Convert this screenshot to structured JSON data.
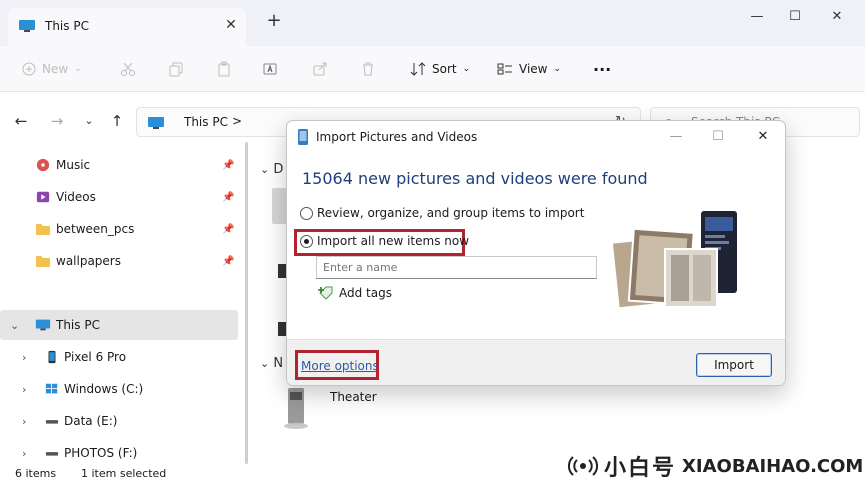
{
  "window": {
    "tab_title": "This PC",
    "tab_close": "✕",
    "new_tab": "+",
    "minimize": "—",
    "maximize": "☐",
    "close": "✕"
  },
  "toolbar": {
    "new_label": "New",
    "sort_label": "Sort",
    "view_label": "View",
    "more_label": "···"
  },
  "address": {
    "path": "This PC",
    "separator": ">",
    "search_placeholder": "Search This PC"
  },
  "sidebar": {
    "items": [
      {
        "label": "Music",
        "pinned": true
      },
      {
        "label": "Videos",
        "pinned": true
      },
      {
        "label": "between_pcs",
        "pinned": true
      },
      {
        "label": "wallpapers",
        "pinned": true
      },
      {
        "label": "This PC",
        "selected": true
      },
      {
        "label": "Pixel 6 Pro"
      },
      {
        "label": "Windows (C:)"
      },
      {
        "label": "Data (E:)"
      },
      {
        "label": "PHOTOS (F:)"
      }
    ]
  },
  "content": {
    "group_d": "D",
    "group_n": "N",
    "theater_label": "Theater"
  },
  "status": {
    "item_count": "6 items",
    "selection": "1 item selected"
  },
  "watermark": {
    "cn": "小白号",
    "en": "XIAOBAIHAO.COM"
  },
  "dialog": {
    "title": "Import Pictures and Videos",
    "heading": "15064 new pictures and videos were found",
    "option_review": "Review, organize, and group items to import",
    "option_import_all": "Import all new items now",
    "name_placeholder": "Enter a name",
    "add_tags": "Add tags",
    "more_options": "More options",
    "import_button": "Import"
  },
  "colors": {
    "accent": "#1f3f7c",
    "highlight": "#b0232f",
    "link": "#2b5aa8"
  }
}
